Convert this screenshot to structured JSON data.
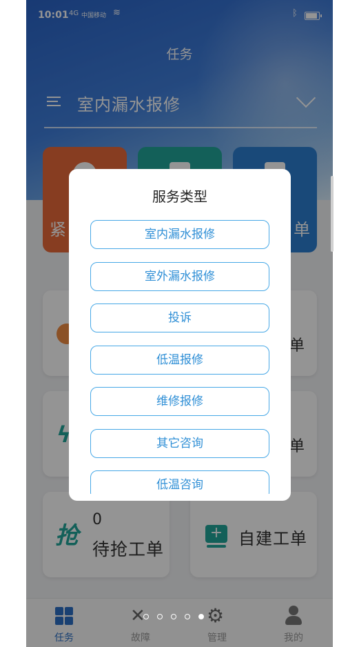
{
  "status_bar": {
    "time": "10:01",
    "signal": "4G",
    "carrier": "中国移动",
    "wifi_icon": "wifi-icon",
    "bluetooth_icon": "bluetooth-icon",
    "battery_icon": "battery-icon"
  },
  "header": {
    "title": "任务",
    "service_type_selected": "室内漏水报修"
  },
  "tiles": {
    "orange_label": "紧",
    "blue_label": "单"
  },
  "cards": {
    "row1_right_label": "单",
    "row2_right_label": "单",
    "grab": {
      "count": "0",
      "label": "待抢工单",
      "icon": "抢"
    },
    "create": {
      "label": "自建工单",
      "icon": "+"
    }
  },
  "dialog": {
    "title": "服务类型",
    "options": [
      "室内漏水报修",
      "室外漏水报修",
      "投诉",
      "低温报修",
      "维修报修",
      "其它咨询",
      "低温咨询"
    ]
  },
  "tabbar": {
    "items": [
      {
        "label": "任务",
        "icon": "grid-icon",
        "active": true
      },
      {
        "label": "故障",
        "icon": "wrench-icon",
        "active": false
      },
      {
        "label": "管理",
        "icon": "gear-icon",
        "active": false
      },
      {
        "label": "我的",
        "icon": "user-icon",
        "active": false
      }
    ]
  },
  "colors": {
    "accent": "#2b6fc4",
    "option_border": "#45a7e6",
    "option_text": "#2f8fd6",
    "tile_orange": "#e86a3a",
    "tile_teal": "#21a59a",
    "tile_blue": "#2b7ed0"
  }
}
